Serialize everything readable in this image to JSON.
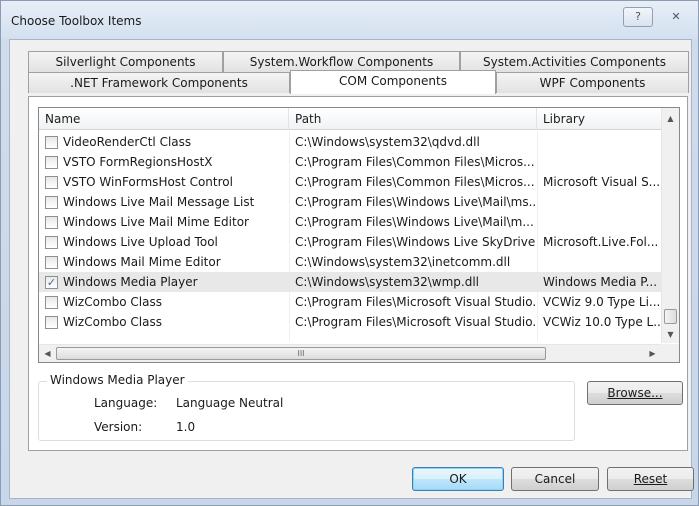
{
  "window": {
    "title": "Choose Toolbox Items",
    "help_glyph": "?",
    "close_glyph": "✕"
  },
  "tabs": {
    "row1": [
      "Silverlight Components",
      "System.Workflow Components",
      "System.Activities Components"
    ],
    "row2": [
      ".NET Framework Components",
      "COM Components",
      "WPF Components"
    ],
    "active": "COM Components"
  },
  "list": {
    "columns": [
      "Name",
      "Path",
      "Library"
    ],
    "rows": [
      {
        "checked": false,
        "name": "VideoRenderCtl Class",
        "path": "C:\\Windows\\system32\\qdvd.dll",
        "library": ""
      },
      {
        "checked": false,
        "name": "VSTO FormRegionsHostX",
        "path": "C:\\Program Files\\Common Files\\Micros...",
        "library": ""
      },
      {
        "checked": false,
        "name": "VSTO WinFormsHost Control",
        "path": "C:\\Program Files\\Common Files\\Micros...",
        "library": "Microsoft Visual S..."
      },
      {
        "checked": false,
        "name": "Windows Live Mail Message List",
        "path": "C:\\Program Files\\Windows Live\\Mail\\ms...",
        "library": ""
      },
      {
        "checked": false,
        "name": "Windows Live Mail Mime Editor",
        "path": "C:\\Program Files\\Windows Live\\Mail\\m...",
        "library": ""
      },
      {
        "checked": false,
        "name": "Windows Live Upload Tool",
        "path": "C:\\Program Files\\Windows Live SkyDrive...",
        "library": "Microsoft.Live.Fol..."
      },
      {
        "checked": false,
        "name": "Windows Mail Mime Editor",
        "path": "C:\\Windows\\system32\\inetcomm.dll",
        "library": ""
      },
      {
        "checked": true,
        "name": "Windows Media Player",
        "path": "C:\\Windows\\system32\\wmp.dll",
        "library": "Windows Media P...",
        "selected": true
      },
      {
        "checked": false,
        "name": "WizCombo Class",
        "path": "C:\\Program Files\\Microsoft Visual Studio...",
        "library": "VCWiz 9.0 Type Li..."
      },
      {
        "checked": false,
        "name": "WizCombo Class",
        "path": "C:\\Program Files\\Microsoft Visual Studio...",
        "library": "VCWiz 10.0 Type L..."
      }
    ],
    "hscroll_grip": "III"
  },
  "details": {
    "title": "Windows Media Player",
    "language_label": "Language:",
    "language_value": "Language Neutral",
    "version_label": "Version:",
    "version_value": "1.0"
  },
  "buttons": {
    "browse": "Browse...",
    "ok": "OK",
    "cancel": "Cancel",
    "reset": "Reset"
  }
}
